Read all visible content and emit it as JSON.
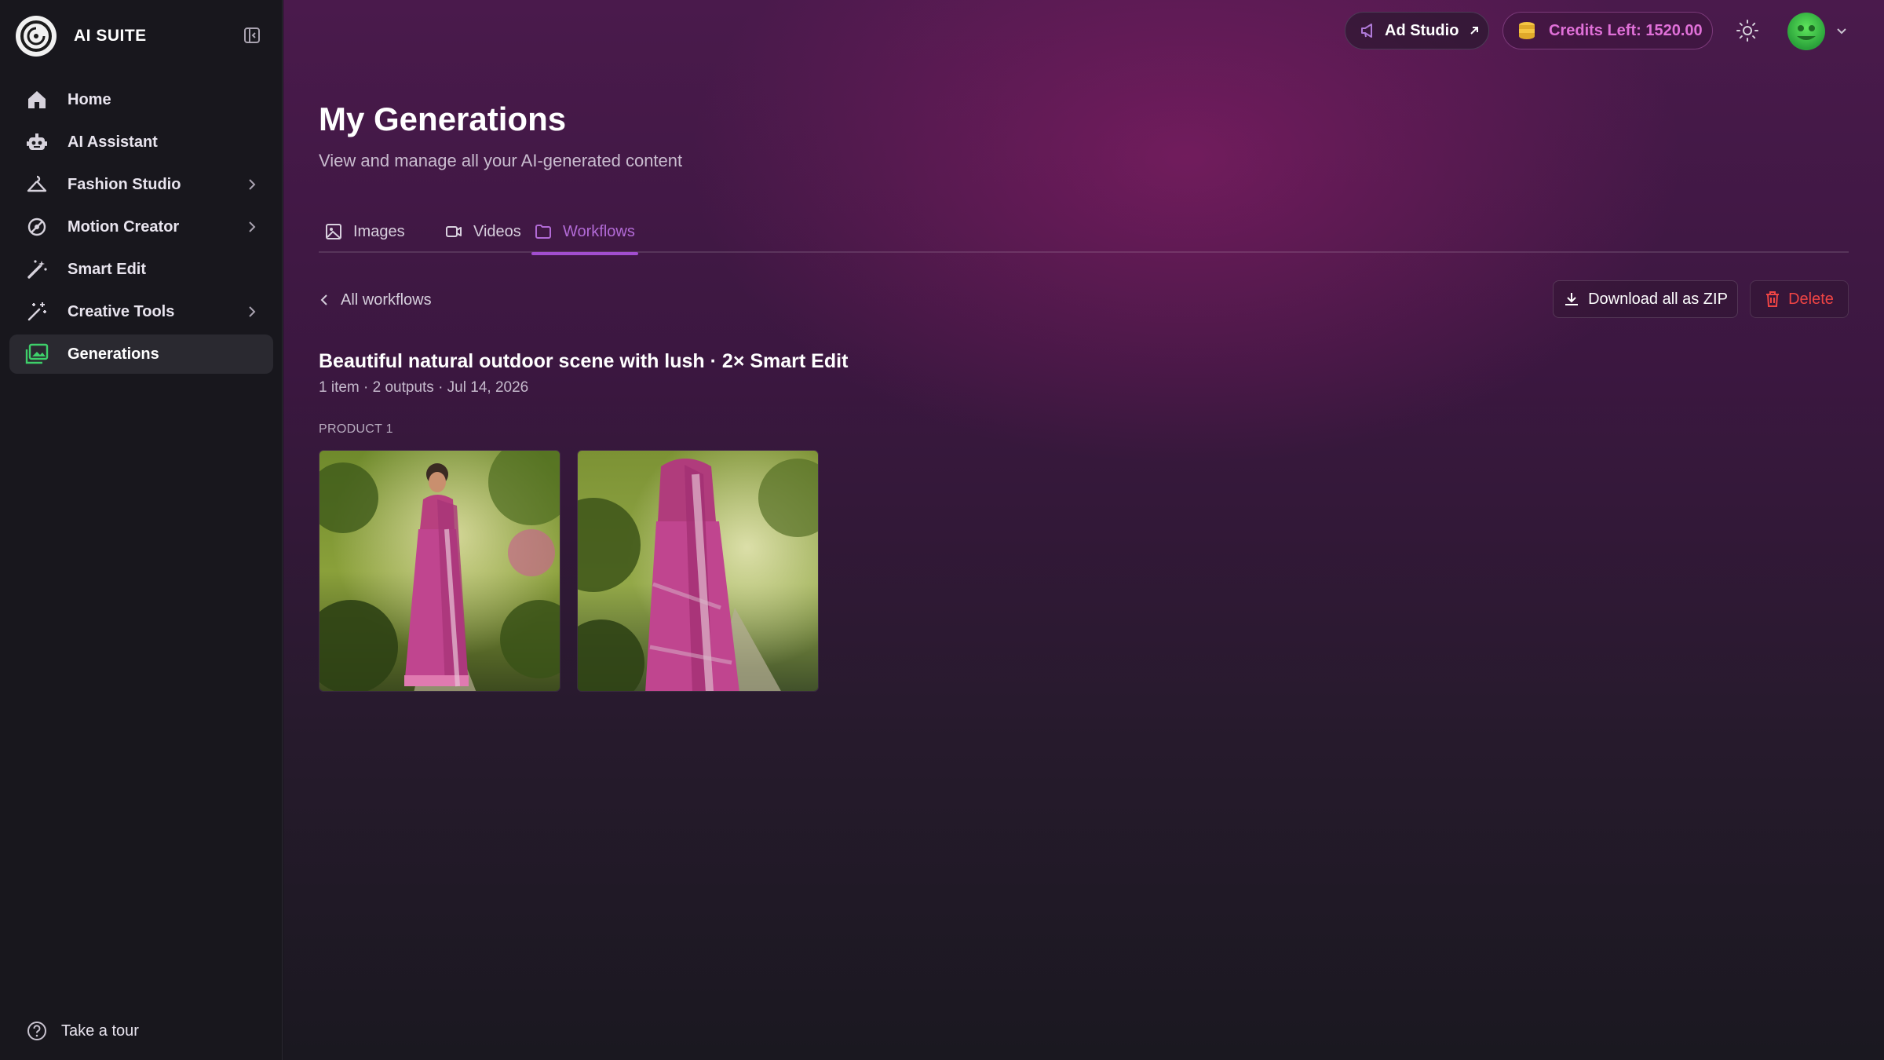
{
  "app": {
    "name": "AI SUITE"
  },
  "sidebar": {
    "items": [
      {
        "label": "Home",
        "icon": "home-icon",
        "has_children": false,
        "active": false
      },
      {
        "label": "AI Assistant",
        "icon": "robot-icon",
        "has_children": false,
        "active": false
      },
      {
        "label": "Fashion Studio",
        "icon": "hanger-icon",
        "has_children": true,
        "active": false
      },
      {
        "label": "Motion Creator",
        "icon": "film-reel-icon",
        "has_children": true,
        "active": false
      },
      {
        "label": "Smart Edit",
        "icon": "magic-wand-icon",
        "has_children": false,
        "active": false
      },
      {
        "label": "Creative Tools",
        "icon": "sparkle-wand-icon",
        "has_children": true,
        "active": false
      },
      {
        "label": "Generations",
        "icon": "gallery-icon",
        "has_children": false,
        "active": true
      }
    ],
    "tour_label": "Take a tour"
  },
  "topbar": {
    "ad_studio_label": "Ad Studio",
    "credits_label": "Credits Left: 1520.00"
  },
  "page": {
    "title": "My Generations",
    "subtitle": "View and manage all your AI-generated content"
  },
  "tabs": [
    {
      "label": "Images",
      "icon": "image-icon",
      "active": false
    },
    {
      "label": "Videos",
      "icon": "video-camera-icon",
      "active": false
    },
    {
      "label": "Workflows",
      "icon": "folder-icon",
      "active": true
    }
  ],
  "workflow": {
    "back_label": "All workflows",
    "download_label": "Download all as ZIP",
    "delete_label": "Delete",
    "title": "Beautiful natural outdoor scene with lush · 2× Smart Edit",
    "meta": "1 item · 2 outputs · Jul 14, 2026",
    "product_label": "PRODUCT 1"
  },
  "colors": {
    "accent": "#a24ed0",
    "credits": "#e070d8",
    "danger": "#ef4444",
    "active_icon": "#3ecf6a",
    "saree_pink": "#c0458f"
  }
}
